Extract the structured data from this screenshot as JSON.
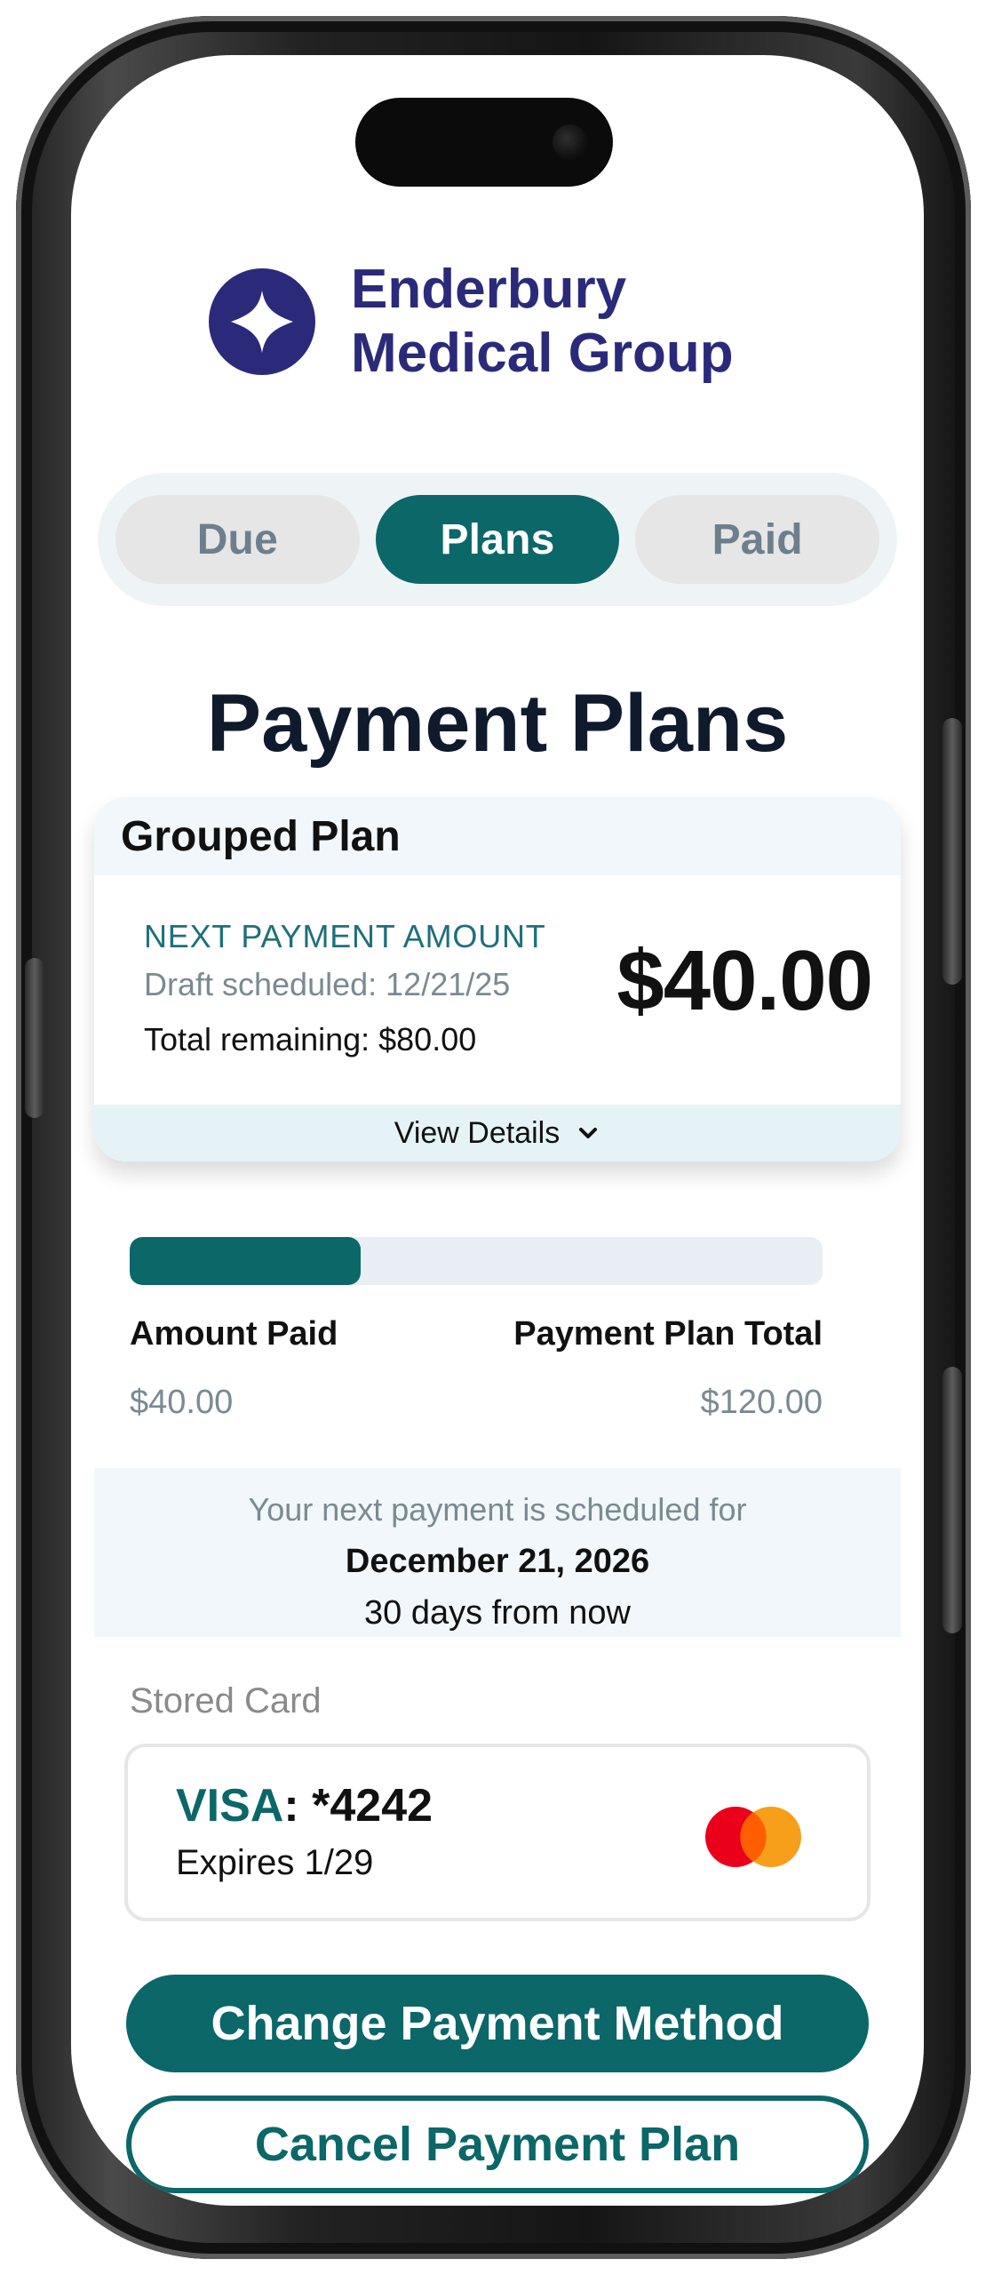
{
  "app": {
    "org_name_line1": "Enderbury",
    "org_name_line2": "Medical Group"
  },
  "tabs": [
    {
      "label": "Due",
      "active": false
    },
    {
      "label": "Plans",
      "active": true
    },
    {
      "label": "Paid",
      "active": false
    }
  ],
  "page": {
    "title": "Payment Plans"
  },
  "plan_card": {
    "title": "Grouped Plan",
    "next_payment_label": "NEXT PAYMENT AMOUNT",
    "draft_scheduled": "Draft scheduled: 12/21/25",
    "total_remaining": "Total remaining: $80.00",
    "next_payment_amount": "$40.00",
    "view_details_label": "View Details"
  },
  "progress": {
    "fraction": 0.333,
    "amount_paid_label": "Amount Paid",
    "amount_paid_value": "$40.00",
    "plan_total_label": "Payment Plan Total",
    "plan_total_value": "$120.00"
  },
  "schedule": {
    "line": "Your next payment is scheduled for",
    "date": "December 21, 2026",
    "relative": "30 days from now"
  },
  "stored_card": {
    "section_label": "Stored Card",
    "brand": "VISA",
    "separator": ": ",
    "number": "*4242",
    "expires": "Expires 1/29",
    "icon": "mastercard-icon"
  },
  "actions": {
    "change_payment_method": "Change Payment Method",
    "cancel_payment_plan": "Cancel Payment Plan"
  },
  "colors": {
    "brand": "#2b2a7a",
    "accent": "#0b6768",
    "muted": "#7a8a92"
  }
}
